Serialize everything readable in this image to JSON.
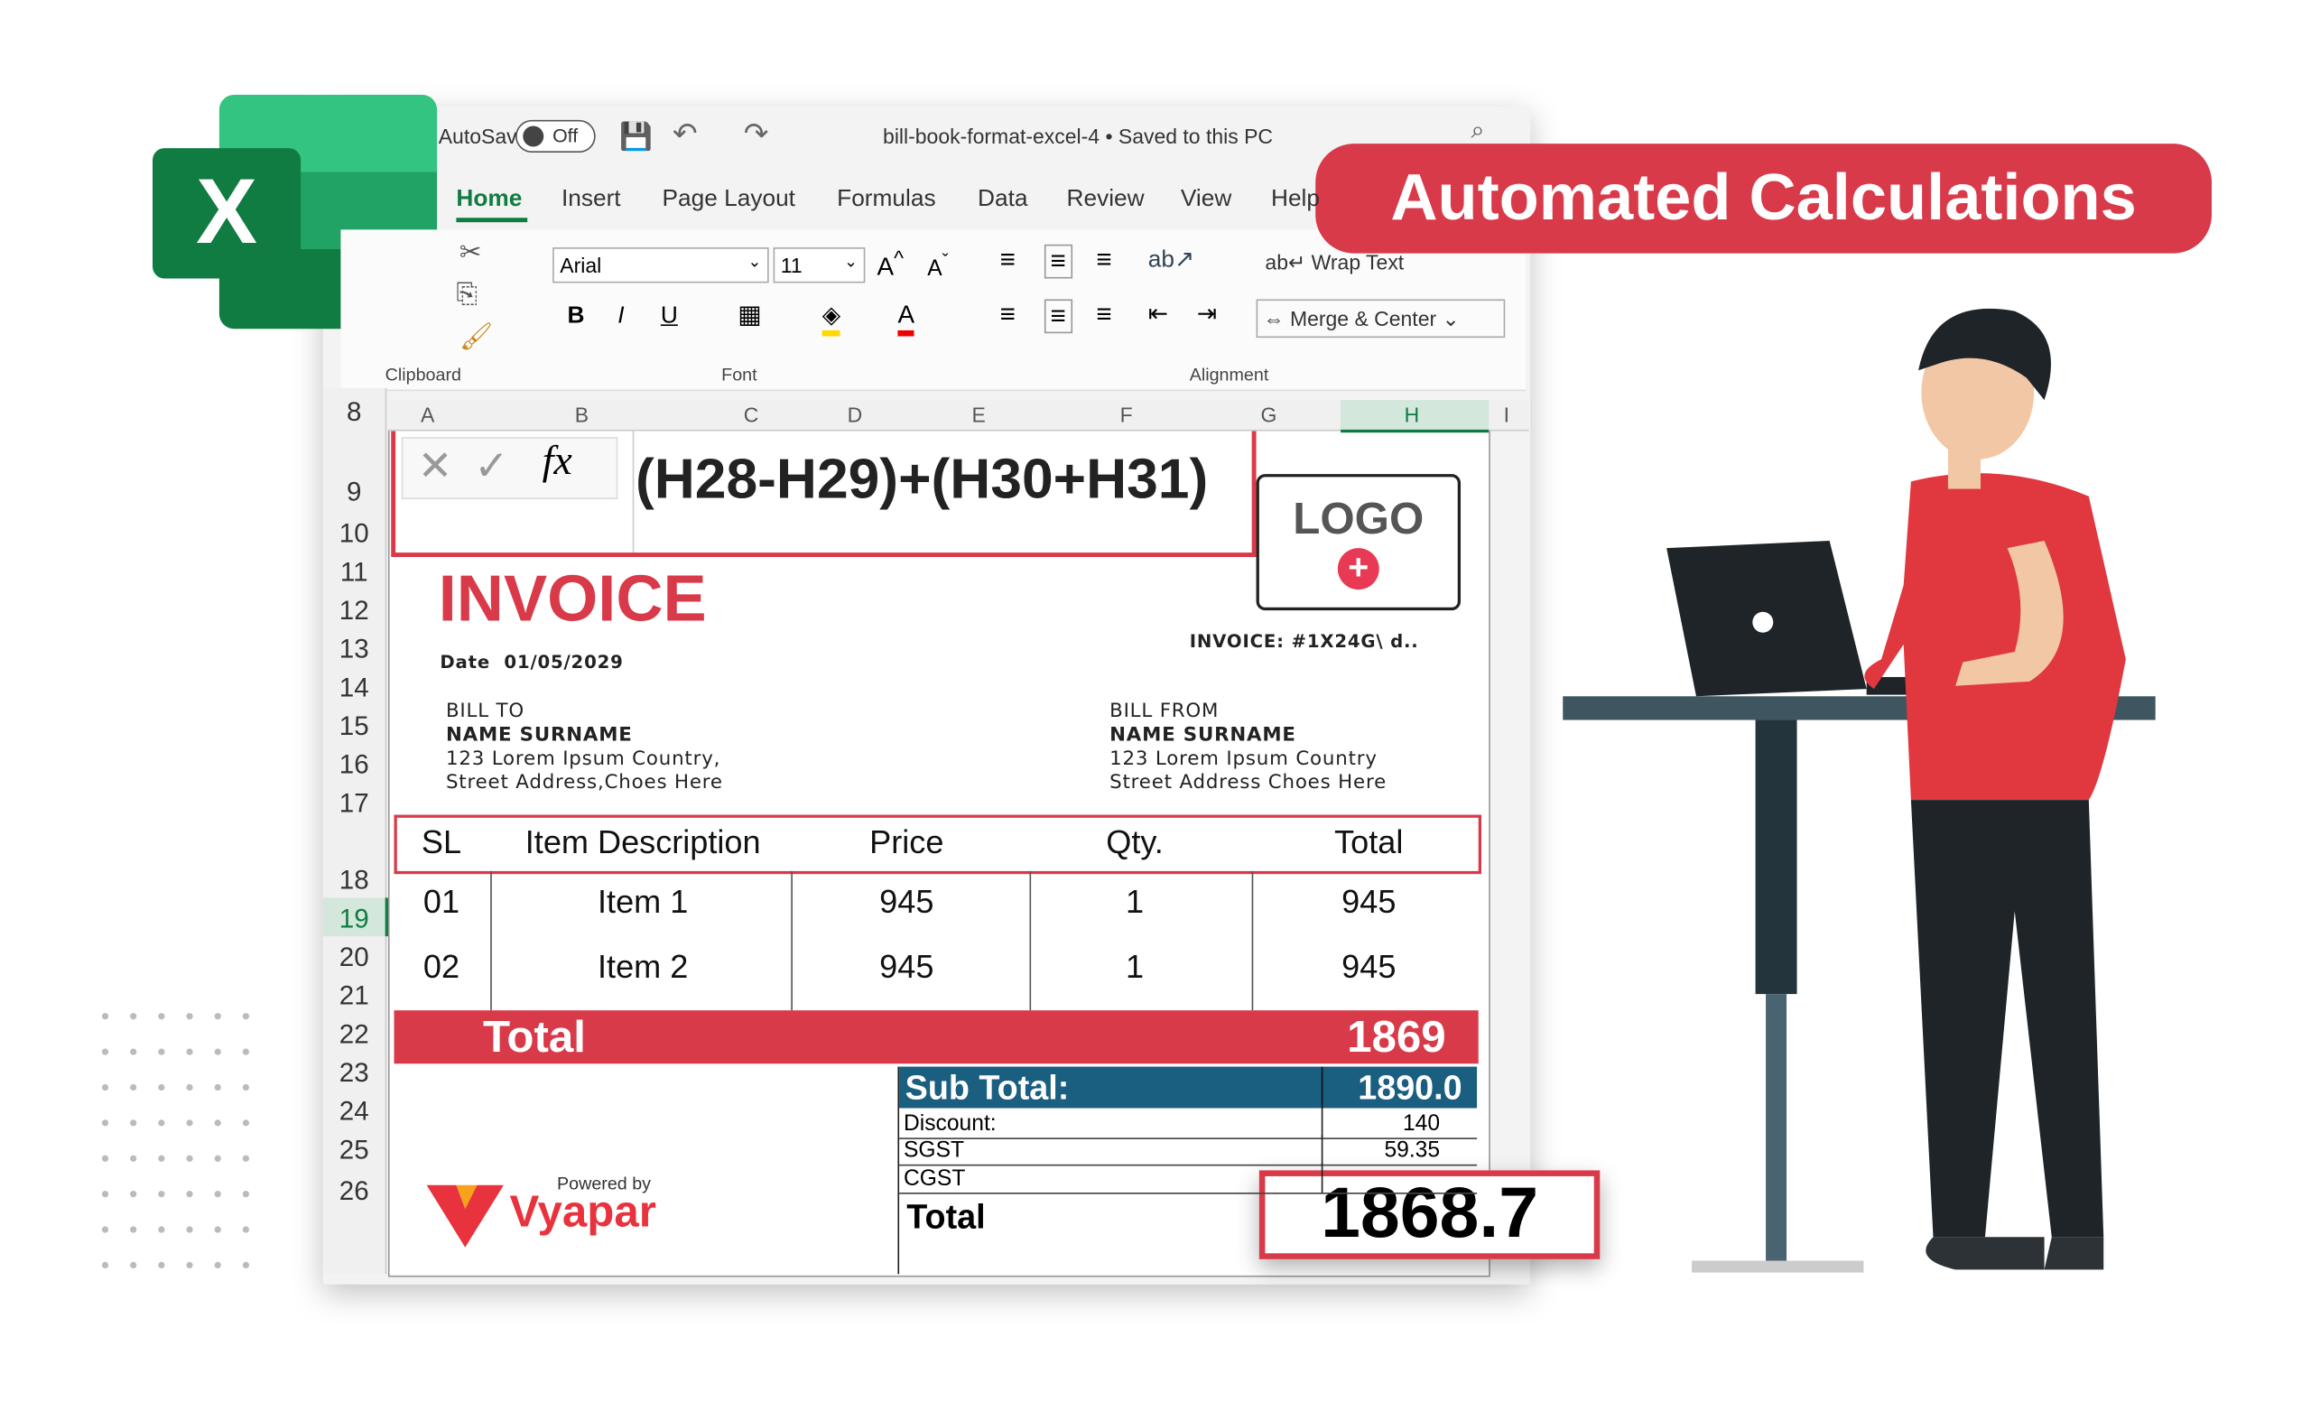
{
  "banner": {
    "title": "Automated Calculations",
    "color": "#d93a49"
  },
  "app": {
    "icon": "excel-logo",
    "autosave_label": "AutoSave",
    "autosave_state": "Off",
    "filename": "bill-book-format-excel-4 • Saved to this PC"
  },
  "menu": {
    "tabs": [
      "Home",
      "Insert",
      "Page Layout",
      "Formulas",
      "Data",
      "Review",
      "View",
      "Help"
    ]
  },
  "ribbon": {
    "font_name": "Arial",
    "font_size": "11",
    "wrap_text": "Wrap Text",
    "merge_center": "Merge & Center",
    "groups": [
      "Clipboard",
      "Font",
      "Alignment"
    ]
  },
  "formula_bar": {
    "fx": "fx",
    "formula": "(H28-H29)+(H30+H31)"
  },
  "columns": [
    "A",
    "B",
    "C",
    "D",
    "E",
    "F",
    "G",
    "H",
    "I"
  ],
  "rows": [
    "8",
    "9",
    "10",
    "11",
    "12",
    "13",
    "14",
    "15",
    "16",
    "17",
    "18",
    "19",
    "20",
    "21",
    "22",
    "23",
    "24",
    "25",
    "26"
  ],
  "invoice": {
    "title": "INVOICE",
    "date_label": "Date",
    "date": "01/05/2029",
    "number": "INVOICE: #1X24G\\ d..",
    "logo": "LOGO",
    "bill_to": {
      "label": "BILL TO",
      "name": "NAME SURNAME",
      "line1": "123 Lorem Ipsum Country,",
      "line2": "Street Address,Choes Here"
    },
    "bill_from": {
      "label": "BILL FROM",
      "name": "NAME SURNAME",
      "line1": "123 Lorem Ipsum Country",
      "line2": "Street Address Choes Here"
    },
    "headers": [
      "SL",
      "Item Description",
      "Price",
      "Qty.",
      "Total"
    ],
    "items": [
      {
        "sl": "01",
        "desc": "Item 1",
        "price": "945",
        "qty": "1",
        "total": "945"
      },
      {
        "sl": "02",
        "desc": "Item 2",
        "price": "945",
        "qty": "1",
        "total": "945"
      }
    ],
    "total_label": "Total",
    "total_value": "1869",
    "subtotal_label": "Sub Total:",
    "subtotal_value": "1890.0",
    "discount_label": "Discount:",
    "discount_value": "140",
    "sgst_label": "SGST",
    "sgst_value": "59.35",
    "cgst_label": "CGST",
    "grand_label": "Total",
    "grand_value": "1868.7",
    "powered_by": "Powered by",
    "brand": "Vyapar"
  }
}
